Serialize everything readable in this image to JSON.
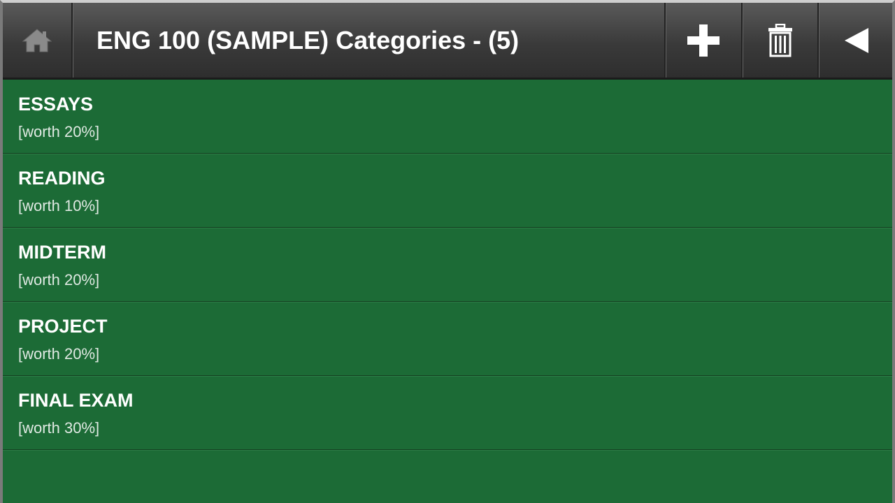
{
  "header": {
    "title": "ENG 100 (SAMPLE) Categories - (5)"
  },
  "icons": {
    "home": "home-icon",
    "add": "plus-icon",
    "delete": "trash-icon",
    "back": "back-arrow-icon"
  },
  "colors": {
    "list_background": "#1c6b36",
    "header_background": "#3a3a3a",
    "text": "#ffffff"
  },
  "categories": [
    {
      "name": "ESSAYS",
      "worth": "[worth 20%]"
    },
    {
      "name": "READING",
      "worth": "[worth 10%]"
    },
    {
      "name": "MIDTERM",
      "worth": "[worth 20%]"
    },
    {
      "name": "PROJECT",
      "worth": "[worth 20%]"
    },
    {
      "name": "FINAL EXAM",
      "worth": "[worth 30%]"
    }
  ]
}
